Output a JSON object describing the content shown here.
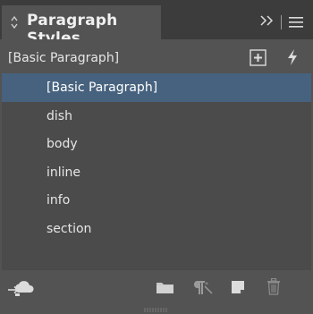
{
  "panel": {
    "title": "Paragraph Styles",
    "current_style": "[Basic Paragraph]"
  },
  "styles": {
    "items": [
      {
        "label": "[Basic Paragraph]",
        "selected": true
      },
      {
        "label": "dish",
        "selected": false
      },
      {
        "label": "body",
        "selected": false
      },
      {
        "label": "inline",
        "selected": false
      },
      {
        "label": "info",
        "selected": false
      },
      {
        "label": "section",
        "selected": false
      }
    ]
  },
  "icons": {
    "tab": "up-down-arrows-icon",
    "collapse": "double-chevron-right-icon",
    "menu": "hamburger-menu-icon",
    "new_group": "new-style-group-icon",
    "quick_apply": "lightning-icon",
    "cc_libraries": "cloud-upload-icon",
    "folder": "folder-icon",
    "clear_overrides": "pilcrow-clear-overrides-icon",
    "new_style": "new-style-icon",
    "delete": "trash-icon"
  },
  "colors": {
    "selection": "#46627e",
    "panel": "#535353",
    "list_bg": "#4b4b4b"
  }
}
